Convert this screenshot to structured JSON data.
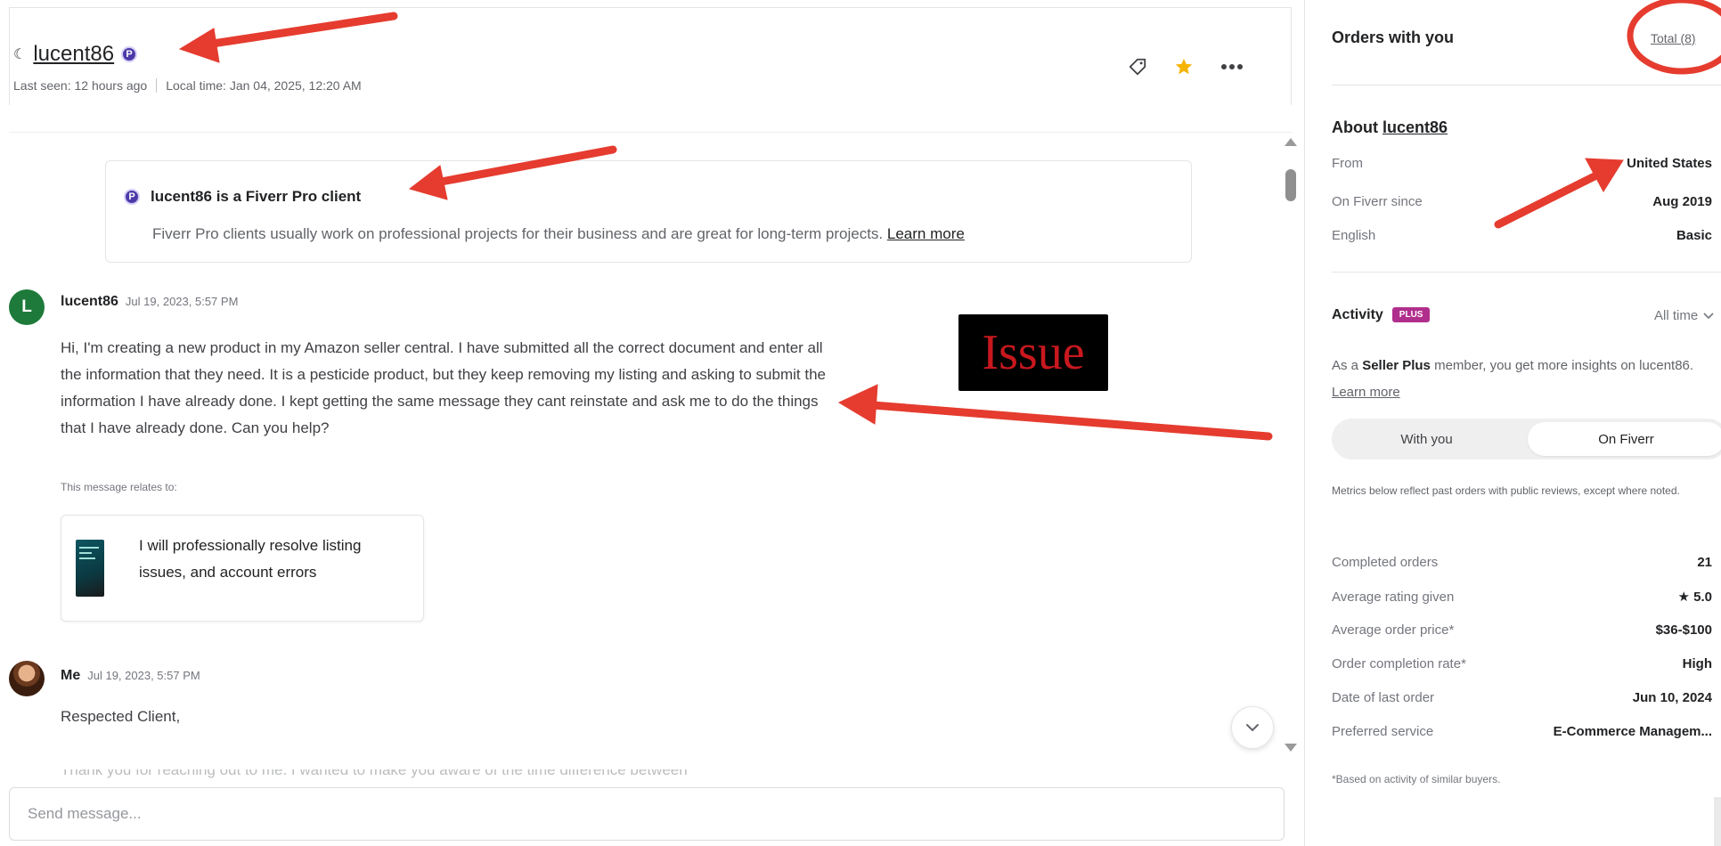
{
  "header": {
    "username": "lucent86",
    "pro_badge_glyph": "P",
    "last_seen": "Last seen: 12 hours ago",
    "local_time": "Local time: Jan 04, 2025, 12:20 AM"
  },
  "pro_notice": {
    "title": "lucent86 is a Fiverr Pro client",
    "description": "Fiverr Pro clients usually work on professional projects for their business and are great for long-term projects.",
    "link": "Learn more"
  },
  "messages": [
    {
      "avatar_letter": "L",
      "sender": "lucent86",
      "timestamp": "Jul 19, 2023, 5:57 PM",
      "body": "Hi, I'm creating a new product in my Amazon seller central. I have submitted all the correct document and enter all the information that they need.  It is a pesticide product, but they keep removing my listing and asking to submit the information I have already done.  I kept getting the same message they cant reinstate and ask me to do the things that I have already done.  Can you help?",
      "relates_label": "This message relates to:",
      "gig_title": "I will professionally resolve listing issues, and account errors"
    },
    {
      "sender": "Me",
      "timestamp": "Jul 19, 2023, 5:57 PM",
      "greeting": "Respected Client,",
      "preview": "Thank you for reaching out to me. I wanted to make you aware of the time difference between"
    }
  ],
  "annotation": {
    "issue_label": "Issue"
  },
  "composer": {
    "placeholder": "Send message..."
  },
  "sidebar": {
    "orders_title": "Orders with you",
    "orders_total_link": "Total (8)",
    "about_prefix": "About ",
    "about_user": "lucent86",
    "about_rows": [
      {
        "label": "From",
        "value": "United States"
      },
      {
        "label": "On Fiverr since",
        "value": "Aug 2019"
      },
      {
        "label": "English",
        "value": "Basic"
      }
    ],
    "activity_title": "Activity",
    "plus_badge": "PLUS",
    "time_filter": "All time",
    "plus_note_pre": "As a ",
    "plus_note_bold": "Seller Plus",
    "plus_note_mid": " member, you get more insights on lucent86.",
    "plus_note_link": "Learn more",
    "toggle": {
      "option_1": "With you",
      "option_2": "On Fiverr",
      "selected": "On Fiverr"
    },
    "metrics_note": "Metrics below reflect past orders with public reviews, except where noted.",
    "metrics": [
      {
        "label": "Completed orders",
        "value": "21"
      },
      {
        "label": "Average rating given",
        "value": "★ 5.0"
      },
      {
        "label": "Average order price*",
        "value": "$36-$100"
      },
      {
        "label": "Order completion rate*",
        "value": "High"
      },
      {
        "label": "Date of last order",
        "value": "Jun 10, 2024"
      },
      {
        "label": "Preferred service",
        "value": "E-Commerce Managem..."
      }
    ],
    "footnote": "*Based on activity of similar buyers."
  },
  "colors": {
    "annotation_red": "#e53c2f",
    "pro_purple": "#4b3aa8",
    "plus_magenta": "#b12f8c",
    "star_gold": "#f5b400",
    "avatar_green": "#1e7a3a"
  }
}
